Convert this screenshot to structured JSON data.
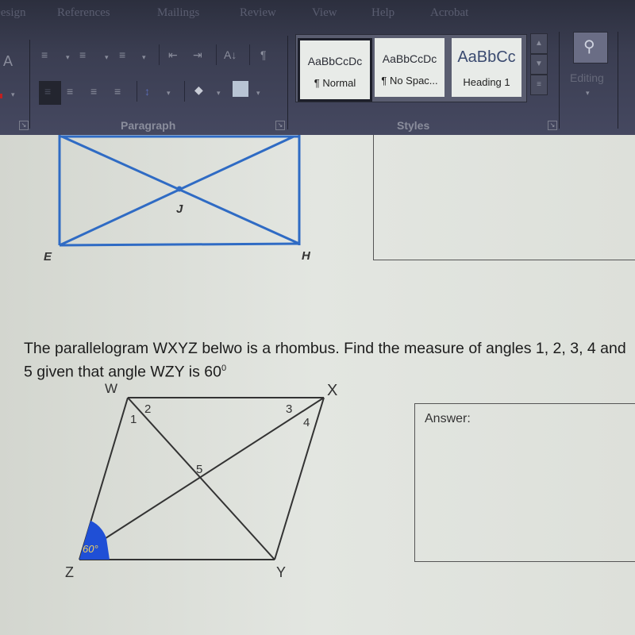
{
  "ribbon": {
    "tabs": [
      "Design",
      "References",
      "Mailings",
      "Review",
      "View",
      "Help",
      "Acrobat"
    ],
    "groups": {
      "paragraph": {
        "label": "Paragraph"
      },
      "styles": {
        "label": "Styles",
        "items": [
          {
            "sample": "AaBbCcDc",
            "name": "¶ Normal",
            "selected": true
          },
          {
            "sample": "AaBbCcDc",
            "name": "¶ No Spac...",
            "selected": false
          },
          {
            "sample": "AaBbCc",
            "name": "Heading 1",
            "selected": false
          }
        ]
      },
      "editing": {
        "label": "Editing"
      }
    },
    "icons": {
      "bullets": "≡",
      "numbering": "≡",
      "multilevel": "≡",
      "decrease_indent": "⇤",
      "increase_indent": "⇥",
      "sort": "A↓",
      "show_marks": "¶",
      "align_left": "≡",
      "center": "≡",
      "align_right": "≡",
      "justify": "≡",
      "line_spacing": "↕",
      "shading": "◆",
      "borders": "▦",
      "find": "⚲"
    }
  },
  "document": {
    "figure1": {
      "labels": {
        "E": "E",
        "H": "H",
        "J": "J"
      },
      "stroke_color": "#2f6bc4"
    },
    "question_text": "The parallelogram WXYZ belwo is a rhombus. Find the measure of angles 1, 2, 3, 4 and 5 given that angle WZY is 60",
    "question_degree": "0",
    "figure2": {
      "vertices": {
        "W": "W",
        "X": "X",
        "Y": "Y",
        "Z": "Z"
      },
      "angle_labels": [
        "1",
        "2",
        "3",
        "4",
        "5"
      ],
      "annotation": "60°",
      "annotation_color": "#1f4fd6",
      "annotation_text_color": "#f0d060"
    },
    "answer_label": "Answer:"
  }
}
